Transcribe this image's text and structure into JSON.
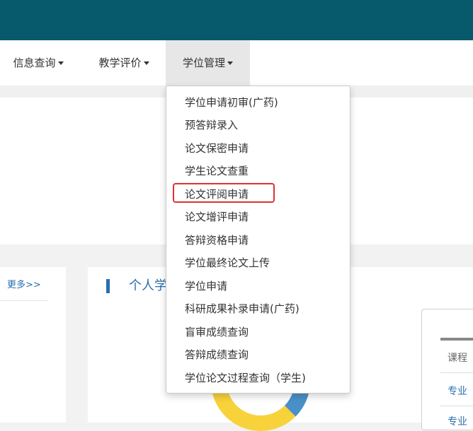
{
  "nav": {
    "items": [
      {
        "label": "信息查询"
      },
      {
        "label": "教学评价"
      },
      {
        "label": "学位管理"
      }
    ]
  },
  "dropdown": {
    "items": [
      "学位申请初审(广药)",
      "预答辩录入",
      "论文保密申请",
      "学生论文查重",
      "论文评阅申请",
      "论文增评申请",
      "答辩资格申请",
      "学位最终论文上传",
      "学位申请",
      "科研成果补录申请(广药)",
      "盲审成绩查询",
      "答辩成绩查询",
      "学位论文过程查询（学生)"
    ],
    "highlighted": "论文评阅申请"
  },
  "left_card": {
    "more_link": "更多>>"
  },
  "main_card": {
    "title": "个人学"
  },
  "course_table": {
    "header": "课程",
    "rows": [
      "专业",
      "专业"
    ]
  },
  "colors": {
    "topbar": "#075a6c",
    "accent": "#2a6eb1",
    "highlight_border": "#e03030",
    "donut_yellow": "#f8d23b",
    "donut_blue": "#4a90c8"
  }
}
